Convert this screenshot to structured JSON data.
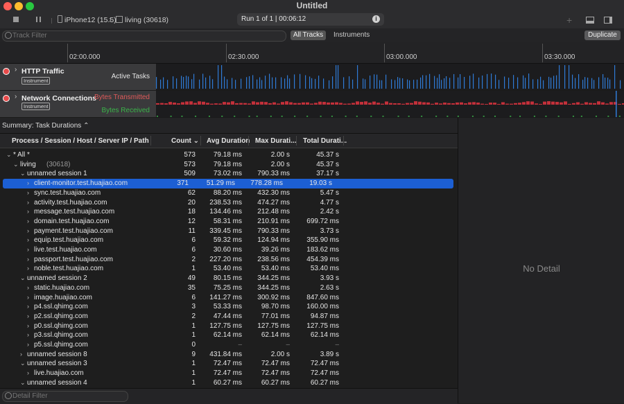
{
  "window": {
    "title": "Untitled"
  },
  "toolbar": {
    "device": "iPhone12 (15.5)",
    "process": "living (30618)",
    "run_status": "Run 1 of 1  |  00:06:12",
    "icons": [
      "stop-icon",
      "pause-icon",
      "phone-icon",
      "app-icon",
      "info-icon",
      "add-icon",
      "panel-bottom-icon",
      "panel-right-icon"
    ]
  },
  "filterbar": {
    "track_filter_placeholder": "Track Filter",
    "all_tracks": "All Tracks",
    "instruments": "Instruments",
    "duplicate": "Duplicate"
  },
  "ruler": {
    "ticks": [
      "02:00.000",
      "02:30.000",
      "03:00.000",
      "03:30.000"
    ]
  },
  "tracks": [
    {
      "title": "HTTP Traffic",
      "badge": "Instrument",
      "label": "Active Tasks"
    },
    {
      "title": "Network Connections",
      "badge": "Instrument",
      "label_top": "Bytes Transmitted",
      "label_bottom": "Bytes Received"
    }
  ],
  "summary": {
    "label": "Summary: Task Durations ⌃"
  },
  "table": {
    "columns": [
      "Process / Session / Host / Server IP / Path",
      "Count ⌄",
      "Avg Duration",
      "Max Durati...",
      "Total Durati..."
    ],
    "rows": [
      {
        "name": "* All *",
        "sub": "",
        "count": "573",
        "avg": "79.18 ms",
        "max": "2.00 s",
        "total": "45.37 s",
        "indent": 0,
        "expanded": true
      },
      {
        "name": "living",
        "sub": "(30618)",
        "count": "573",
        "avg": "79.18 ms",
        "max": "2.00 s",
        "total": "45.37 s",
        "indent": 1,
        "expanded": true
      },
      {
        "name": "unnamed session 1",
        "sub": "",
        "count": "509",
        "avg": "73.02 ms",
        "max": "790.33 ms",
        "total": "37.17 s",
        "indent": 2,
        "expanded": true
      },
      {
        "name": "client-monitor.test.huajiao.com",
        "sub": "",
        "count": "371",
        "avg": "51.29 ms",
        "max": "778.28 ms",
        "total": "19.03 s",
        "indent": 3,
        "selected": true
      },
      {
        "name": "sync.test.huajiao.com",
        "sub": "",
        "count": "62",
        "avg": "88.20 ms",
        "max": "432.30 ms",
        "total": "5.47 s",
        "indent": 3
      },
      {
        "name": "activity.test.huajiao.com",
        "sub": "",
        "count": "20",
        "avg": "238.53 ms",
        "max": "474.27 ms",
        "total": "4.77 s",
        "indent": 3
      },
      {
        "name": "message.test.huajiao.com",
        "sub": "",
        "count": "18",
        "avg": "134.46 ms",
        "max": "212.48 ms",
        "total": "2.42 s",
        "indent": 3
      },
      {
        "name": "domain.test.huajiao.com",
        "sub": "",
        "count": "12",
        "avg": "58.31 ms",
        "max": "210.91 ms",
        "total": "699.72 ms",
        "indent": 3
      },
      {
        "name": "payment.test.huajiao.com",
        "sub": "",
        "count": "11",
        "avg": "339.45 ms",
        "max": "790.33 ms",
        "total": "3.73 s",
        "indent": 3
      },
      {
        "name": "equip.test.huajiao.com",
        "sub": "",
        "count": "6",
        "avg": "59.32 ms",
        "max": "124.94 ms",
        "total": "355.90 ms",
        "indent": 3
      },
      {
        "name": "live.test.huajiao.com",
        "sub": "",
        "count": "6",
        "avg": "30.60 ms",
        "max": "39.26 ms",
        "total": "183.62 ms",
        "indent": 3
      },
      {
        "name": "passport.test.huajiao.com",
        "sub": "",
        "count": "2",
        "avg": "227.20 ms",
        "max": "238.56 ms",
        "total": "454.39 ms",
        "indent": 3
      },
      {
        "name": "noble.test.huajiao.com",
        "sub": "",
        "count": "1",
        "avg": "53.40 ms",
        "max": "53.40 ms",
        "total": "53.40 ms",
        "indent": 3
      },
      {
        "name": "unnamed session 2",
        "sub": "",
        "count": "49",
        "avg": "80.15 ms",
        "max": "344.25 ms",
        "total": "3.93 s",
        "indent": 2,
        "expanded": true
      },
      {
        "name": "static.huajiao.com",
        "sub": "",
        "count": "35",
        "avg": "75.25 ms",
        "max": "344.25 ms",
        "total": "2.63 s",
        "indent": 3
      },
      {
        "name": "image.huajiao.com",
        "sub": "",
        "count": "6",
        "avg": "141.27 ms",
        "max": "300.92 ms",
        "total": "847.60 ms",
        "indent": 3
      },
      {
        "name": "p4.ssl.qhimg.com",
        "sub": "",
        "count": "3",
        "avg": "53.33 ms",
        "max": "98.70 ms",
        "total": "160.00 ms",
        "indent": 3
      },
      {
        "name": "p2.ssl.qhimg.com",
        "sub": "",
        "count": "2",
        "avg": "47.44 ms",
        "max": "77.01 ms",
        "total": "94.87 ms",
        "indent": 3
      },
      {
        "name": "p0.ssl.qhimg.com",
        "sub": "",
        "count": "1",
        "avg": "127.75 ms",
        "max": "127.75 ms",
        "total": "127.75 ms",
        "indent": 3
      },
      {
        "name": "p3.ssl.qhimg.com",
        "sub": "",
        "count": "1",
        "avg": "62.14 ms",
        "max": "62.14 ms",
        "total": "62.14 ms",
        "indent": 3
      },
      {
        "name": "p5.ssl.qhimg.com",
        "sub": "",
        "count": "0",
        "avg": "–",
        "max": "–",
        "total": "–",
        "indent": 3,
        "dim": true
      },
      {
        "name": "unnamed session 8",
        "sub": "",
        "count": "9",
        "avg": "431.84 ms",
        "max": "2.00 s",
        "total": "3.89 s",
        "indent": 2,
        "expanded": false
      },
      {
        "name": "unnamed session 3",
        "sub": "",
        "count": "1",
        "avg": "72.47 ms",
        "max": "72.47 ms",
        "total": "72.47 ms",
        "indent": 2,
        "expanded": true
      },
      {
        "name": "live.huajiao.com",
        "sub": "",
        "count": "1",
        "avg": "72.47 ms",
        "max": "72.47 ms",
        "total": "72.47 ms",
        "indent": 3
      },
      {
        "name": "unnamed session 4",
        "sub": "",
        "count": "1",
        "avg": "60.27 ms",
        "max": "60.27 ms",
        "total": "60.27 ms",
        "indent": 2,
        "expanded": true
      }
    ]
  },
  "detail": {
    "empty_label": "No Detail",
    "filter_placeholder": "Detail Filter"
  },
  "colors": {
    "selection": "#1c5fd3",
    "active_tasks": "#2f7bd6",
    "transmitted": "#c3303a",
    "received": "#3bb54a"
  }
}
